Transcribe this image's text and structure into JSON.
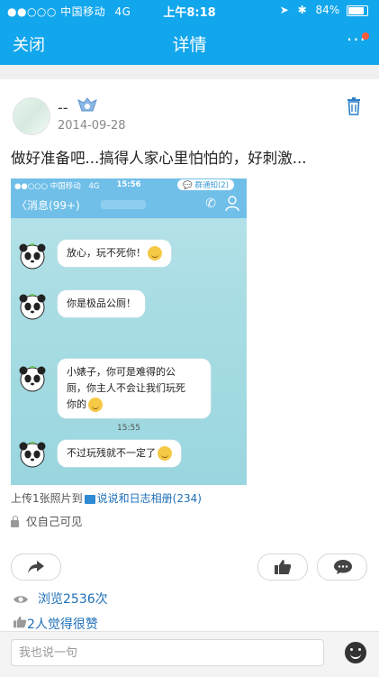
{
  "status_bar": {
    "carrier": "●●○○○ 中国移动",
    "network": "4G",
    "time": "上午8:18",
    "battery": "84%",
    "battery_level": 0.84
  },
  "nav": {
    "close_label": "关闭",
    "title": "详情",
    "more_label": "···"
  },
  "post": {
    "username": "--",
    "date": "2014-09-28",
    "text": "做好准备吧...搞得人家心里怕怕的，好刺激...",
    "screenshot": {
      "status_carrier": "●●○○○ 中国移动",
      "status_network": "4G",
      "status_time": "15:56",
      "status_notice": "群通知(2)",
      "back_label": "消息(99+)",
      "messages": [
        {
          "text": "放心，玩不死你！"
        },
        {
          "text": "你是极品公厕！"
        },
        {
          "text": "小婊子，你可是难得的公厕，你主人不会让我们玩死你的"
        },
        {
          "text": "不过玩残就不一定了"
        }
      ],
      "message_lines": {
        "m3_line1": "小婊子，你可是难得的公",
        "m3_line2": "厕，你主人不会让我们玩死",
        "m3_line3": "你的"
      },
      "time_divider": "15:55"
    },
    "upload_prefix": "上传1张照片到",
    "upload_album": "说说和日志相册(234)",
    "privacy": "仅自己可见",
    "views": "浏览2536次",
    "likes": "2人觉得很赞"
  },
  "comment_input": {
    "placeholder": "我也说一句"
  },
  "colors": {
    "brand_blue": "#12a6ec",
    "link_blue": "#1e6fb8",
    "notification_red": "#ff5a3c"
  }
}
